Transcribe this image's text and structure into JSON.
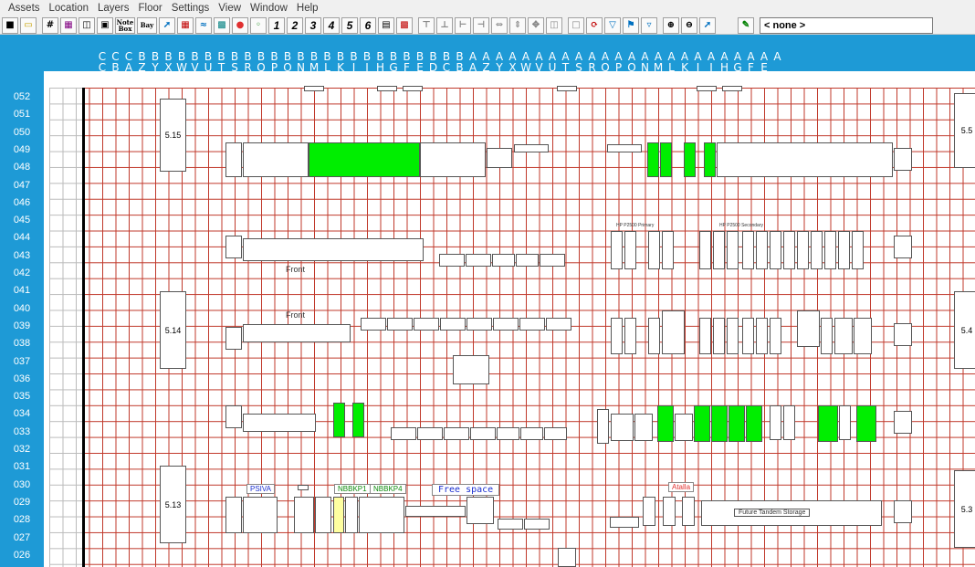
{
  "menu": [
    "Assets",
    "Location",
    "Layers",
    "Floor",
    "Settings",
    "View",
    "Window",
    "Help"
  ],
  "toolbar": {
    "nums": [
      "1",
      "2",
      "3",
      "4",
      "5",
      "6"
    ],
    "layer_value": "< none >",
    "note_box": "Note Box",
    "bay": "Bay"
  },
  "columns": {
    "top": [
      "C",
      "C",
      "C",
      "B",
      "B",
      "B",
      "B",
      "B",
      "B",
      "B",
      "B",
      "B",
      "B",
      "B",
      "B",
      "B",
      "B",
      "B",
      "B",
      "B",
      "B",
      "B",
      "B",
      "B",
      "B",
      "B",
      "B",
      "B",
      "A",
      "A",
      "A",
      "A",
      "A",
      "A",
      "A",
      "A",
      "A",
      "A",
      "A",
      "A",
      "A",
      "A",
      "A",
      "A",
      "A",
      "A",
      "A",
      "A",
      "A",
      "A",
      "A",
      "A"
    ],
    "bottom": [
      "C",
      "B",
      "A",
      "Z",
      "Y",
      "X",
      "W",
      "V",
      "U",
      "T",
      "S",
      "R",
      "Q",
      "P",
      "O",
      "N",
      "M",
      "L",
      "K",
      "J",
      "I",
      "H",
      "G",
      "F",
      "E",
      "D",
      "C",
      "B",
      "A",
      "Z",
      "Y",
      "X",
      "W",
      "V",
      "U",
      "T",
      "S",
      "R",
      "Q",
      "P",
      "O",
      "N",
      "M",
      "L",
      "K",
      "J",
      "I",
      "H",
      "G",
      "F",
      "E",
      ""
    ]
  },
  "rows": [
    "052",
    "051",
    "050",
    "049",
    "048",
    "047",
    "046",
    "045",
    "044",
    "043",
    "042",
    "041",
    "040",
    "039",
    "038",
    "037",
    "036",
    "035",
    "034",
    "033",
    "032",
    "031",
    "030",
    "029",
    "028",
    "027",
    "026"
  ],
  "rooms": {
    "left": [
      {
        "label": "5.15"
      },
      {
        "label": "5.14"
      },
      {
        "label": "5.13"
      }
    ],
    "right": [
      {
        "label": "5.5"
      },
      {
        "label": "5.4"
      },
      {
        "label": "5.3"
      }
    ]
  },
  "labels": {
    "front1": "Front",
    "front2": "Front",
    "psiva": "PSIVA",
    "nbbkp1": "NBBKP1",
    "nbbkp4": "NBBKP4",
    "free_space": "Free space",
    "atalla": "Atalla",
    "future_tandem": "Future Tandem Storage",
    "hp_primary": "HP P2500 Primary",
    "hp_secondary": "HP P2500 Secondary"
  },
  "colors": {
    "header_bg": "#1e9ad6",
    "grid_line": "#c0392b",
    "green": "#00ee00"
  }
}
